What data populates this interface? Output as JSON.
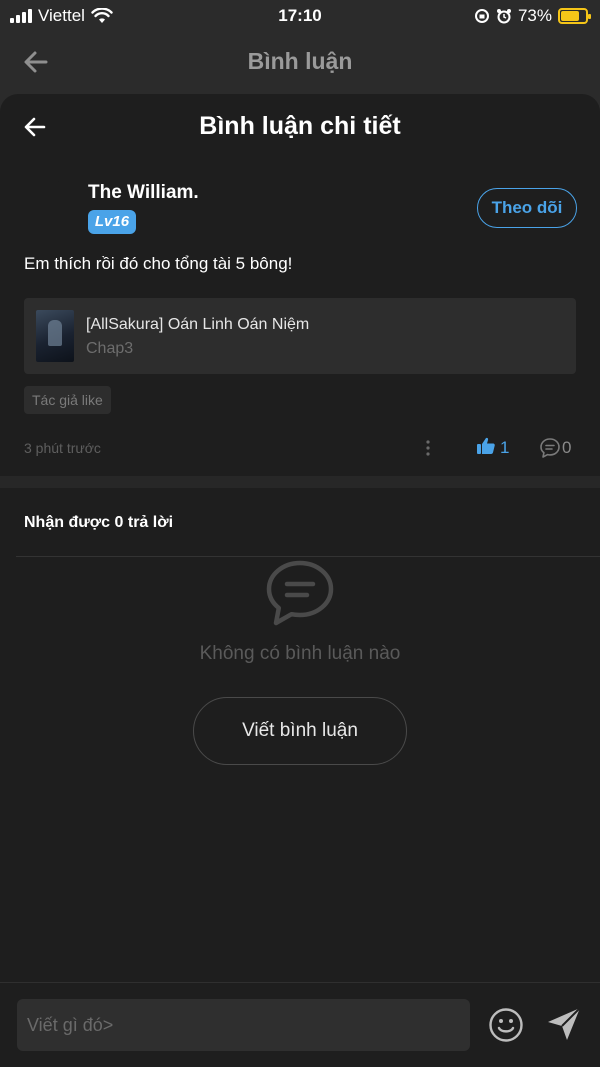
{
  "status_bar": {
    "carrier": "Viettel",
    "time": "17:10",
    "battery": "73%",
    "battery_level": 0.73
  },
  "background_header": {
    "title": "Bình luận"
  },
  "sheet": {
    "title": "Bình luận chi tiết",
    "user": {
      "name": "The William.",
      "level": "Lv16",
      "follow_label": "Theo dõi"
    },
    "comment": "Em thích rồi đó cho tổng tài 5 bông!",
    "story": {
      "title": "[AllSakura] Oán Linh Oán Niệm",
      "chapter": "Chap3"
    },
    "tag": "Tác giả like",
    "time_ago": "3 phút trước",
    "like_count": "1",
    "reply_count": "0",
    "replies_heading": "Nhận được 0 trả lời",
    "empty_text": "Không có bình luận nào",
    "write_comment_label": "Viết bình luận"
  },
  "composer": {
    "placeholder": "Viết gì đó>"
  },
  "colors": {
    "accent": "#4aa3e8",
    "battery": "#f5c518",
    "sheet_bg": "#1e1e1e"
  }
}
